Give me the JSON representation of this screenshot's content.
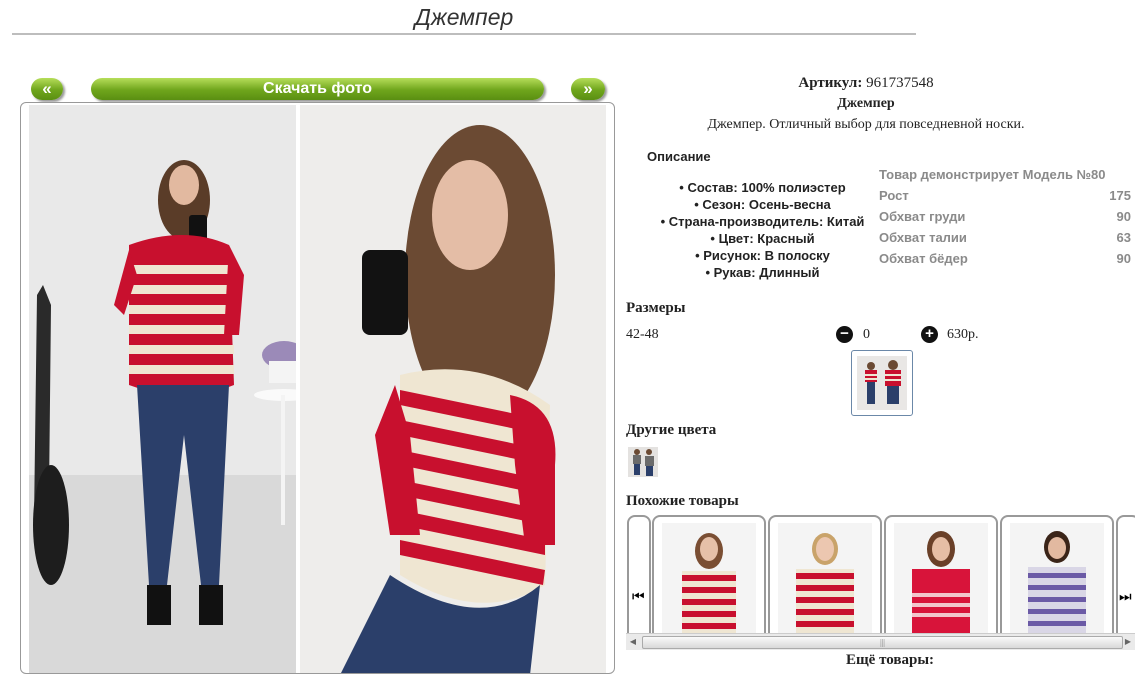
{
  "page": {
    "title": "Джемпер"
  },
  "gallery": {
    "prev_label": "«",
    "download_label": "Скачать фото",
    "next_label": "»"
  },
  "product": {
    "article_label": "Артикул:",
    "article_value": "961737548",
    "name": "Джемпер",
    "description": "Джемпер. Отличный выбор для повседневной носки."
  },
  "description_section": {
    "heading": "Описание",
    "props": [
      "Состав: 100% полиэстер",
      "Сезон: Осень-весна",
      "Страна-производитель: Китай",
      "Цвет: Красный",
      "Рисунок: В полоску",
      "Рукав: Длинный"
    ]
  },
  "model": {
    "heading": "Товар демонстрирует Модель №80",
    "rows": [
      {
        "label": "Рост",
        "value": "175"
      },
      {
        "label": "Обхват груди",
        "value": "90"
      },
      {
        "label": "Обхват талии",
        "value": "63"
      },
      {
        "label": "Обхват бёдер",
        "value": "90"
      }
    ]
  },
  "sizes": {
    "heading": "Размеры",
    "rows": [
      {
        "size": "42-48",
        "minus": "−",
        "qty": "0",
        "plus": "+",
        "price": "630р."
      }
    ]
  },
  "other_colors": {
    "heading": "Другие цвета"
  },
  "similar": {
    "heading": "Похожие товары",
    "prev_icon": "⏮",
    "next_icon": "⏭"
  },
  "scrollbar": {
    "left_arrow": "◀",
    "grip": "|||",
    "right_arrow": "▶"
  },
  "more": {
    "label": "Ещё товары:"
  },
  "colors": {
    "button_green": "#6fa51c",
    "stripe_red": "#c8102e",
    "stripe_cream": "#efe6d2",
    "purple_stripe": "#6b5aa6"
  }
}
